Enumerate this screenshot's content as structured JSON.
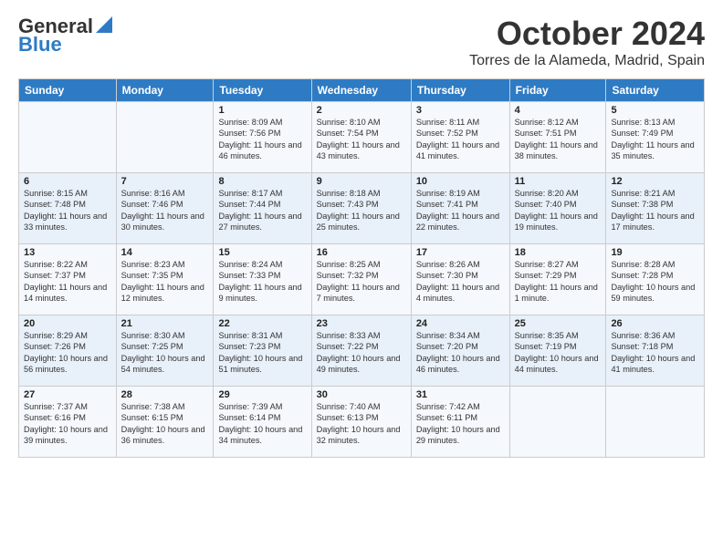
{
  "header": {
    "logo_line1": "General",
    "logo_line2": "Blue",
    "month": "October 2024",
    "location": "Torres de la Alameda, Madrid, Spain"
  },
  "columns": [
    "Sunday",
    "Monday",
    "Tuesday",
    "Wednesday",
    "Thursday",
    "Friday",
    "Saturday"
  ],
  "weeks": [
    [
      {
        "day": "",
        "info": ""
      },
      {
        "day": "",
        "info": ""
      },
      {
        "day": "1",
        "info": "Sunrise: 8:09 AM\nSunset: 7:56 PM\nDaylight: 11 hours and 46 minutes."
      },
      {
        "day": "2",
        "info": "Sunrise: 8:10 AM\nSunset: 7:54 PM\nDaylight: 11 hours and 43 minutes."
      },
      {
        "day": "3",
        "info": "Sunrise: 8:11 AM\nSunset: 7:52 PM\nDaylight: 11 hours and 41 minutes."
      },
      {
        "day": "4",
        "info": "Sunrise: 8:12 AM\nSunset: 7:51 PM\nDaylight: 11 hours and 38 minutes."
      },
      {
        "day": "5",
        "info": "Sunrise: 8:13 AM\nSunset: 7:49 PM\nDaylight: 11 hours and 35 minutes."
      }
    ],
    [
      {
        "day": "6",
        "info": "Sunrise: 8:15 AM\nSunset: 7:48 PM\nDaylight: 11 hours and 33 minutes."
      },
      {
        "day": "7",
        "info": "Sunrise: 8:16 AM\nSunset: 7:46 PM\nDaylight: 11 hours and 30 minutes."
      },
      {
        "day": "8",
        "info": "Sunrise: 8:17 AM\nSunset: 7:44 PM\nDaylight: 11 hours and 27 minutes."
      },
      {
        "day": "9",
        "info": "Sunrise: 8:18 AM\nSunset: 7:43 PM\nDaylight: 11 hours and 25 minutes."
      },
      {
        "day": "10",
        "info": "Sunrise: 8:19 AM\nSunset: 7:41 PM\nDaylight: 11 hours and 22 minutes."
      },
      {
        "day": "11",
        "info": "Sunrise: 8:20 AM\nSunset: 7:40 PM\nDaylight: 11 hours and 19 minutes."
      },
      {
        "day": "12",
        "info": "Sunrise: 8:21 AM\nSunset: 7:38 PM\nDaylight: 11 hours and 17 minutes."
      }
    ],
    [
      {
        "day": "13",
        "info": "Sunrise: 8:22 AM\nSunset: 7:37 PM\nDaylight: 11 hours and 14 minutes."
      },
      {
        "day": "14",
        "info": "Sunrise: 8:23 AM\nSunset: 7:35 PM\nDaylight: 11 hours and 12 minutes."
      },
      {
        "day": "15",
        "info": "Sunrise: 8:24 AM\nSunset: 7:33 PM\nDaylight: 11 hours and 9 minutes."
      },
      {
        "day": "16",
        "info": "Sunrise: 8:25 AM\nSunset: 7:32 PM\nDaylight: 11 hours and 7 minutes."
      },
      {
        "day": "17",
        "info": "Sunrise: 8:26 AM\nSunset: 7:30 PM\nDaylight: 11 hours and 4 minutes."
      },
      {
        "day": "18",
        "info": "Sunrise: 8:27 AM\nSunset: 7:29 PM\nDaylight: 11 hours and 1 minute."
      },
      {
        "day": "19",
        "info": "Sunrise: 8:28 AM\nSunset: 7:28 PM\nDaylight: 10 hours and 59 minutes."
      }
    ],
    [
      {
        "day": "20",
        "info": "Sunrise: 8:29 AM\nSunset: 7:26 PM\nDaylight: 10 hours and 56 minutes."
      },
      {
        "day": "21",
        "info": "Sunrise: 8:30 AM\nSunset: 7:25 PM\nDaylight: 10 hours and 54 minutes."
      },
      {
        "day": "22",
        "info": "Sunrise: 8:31 AM\nSunset: 7:23 PM\nDaylight: 10 hours and 51 minutes."
      },
      {
        "day": "23",
        "info": "Sunrise: 8:33 AM\nSunset: 7:22 PM\nDaylight: 10 hours and 49 minutes."
      },
      {
        "day": "24",
        "info": "Sunrise: 8:34 AM\nSunset: 7:20 PM\nDaylight: 10 hours and 46 minutes."
      },
      {
        "day": "25",
        "info": "Sunrise: 8:35 AM\nSunset: 7:19 PM\nDaylight: 10 hours and 44 minutes."
      },
      {
        "day": "26",
        "info": "Sunrise: 8:36 AM\nSunset: 7:18 PM\nDaylight: 10 hours and 41 minutes."
      }
    ],
    [
      {
        "day": "27",
        "info": "Sunrise: 7:37 AM\nSunset: 6:16 PM\nDaylight: 10 hours and 39 minutes."
      },
      {
        "day": "28",
        "info": "Sunrise: 7:38 AM\nSunset: 6:15 PM\nDaylight: 10 hours and 36 minutes."
      },
      {
        "day": "29",
        "info": "Sunrise: 7:39 AM\nSunset: 6:14 PM\nDaylight: 10 hours and 34 minutes."
      },
      {
        "day": "30",
        "info": "Sunrise: 7:40 AM\nSunset: 6:13 PM\nDaylight: 10 hours and 32 minutes."
      },
      {
        "day": "31",
        "info": "Sunrise: 7:42 AM\nSunset: 6:11 PM\nDaylight: 10 hours and 29 minutes."
      },
      {
        "day": "",
        "info": ""
      },
      {
        "day": "",
        "info": ""
      }
    ]
  ]
}
